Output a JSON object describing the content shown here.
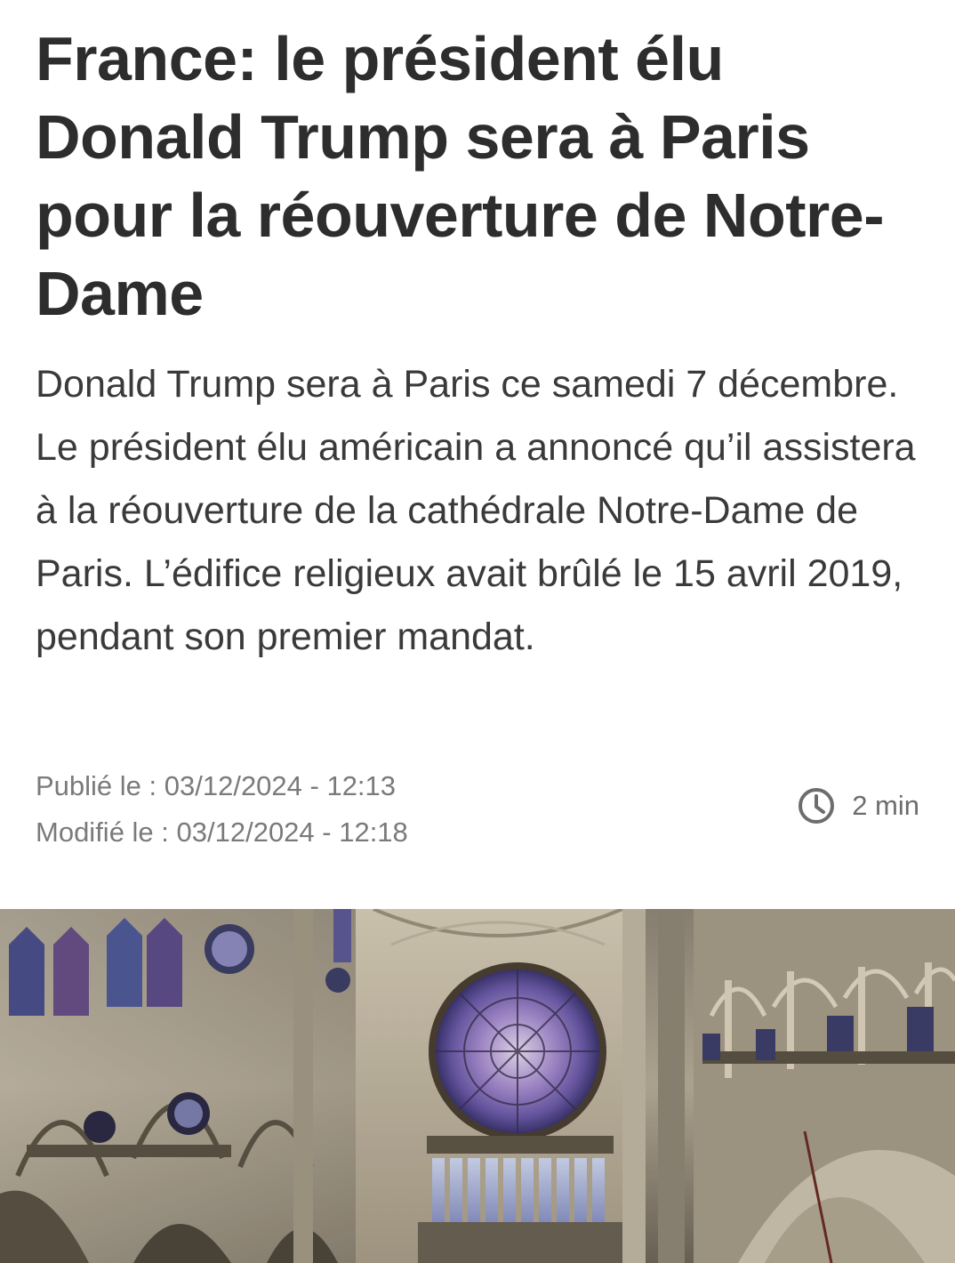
{
  "article": {
    "headline": "France: le président élu Donald Trump sera à Paris pour la réouverture de Notre-Dame",
    "lead": "Donald Trump sera à Paris ce samedi 7 décembre. Le président élu américain a annoncé qu’il assistera à la réouverture de la cathédrale Notre-Dame de Paris. L’édifice religieux avait brûlé le 15 avril 2019, pendant son premier mandat.",
    "published": "Publié le : 03/12/2024 - 12:13",
    "modified": "Modifié le : 03/12/2024 - 12:18",
    "read_time": "2 min",
    "read_time_icon": "clock-icon"
  }
}
